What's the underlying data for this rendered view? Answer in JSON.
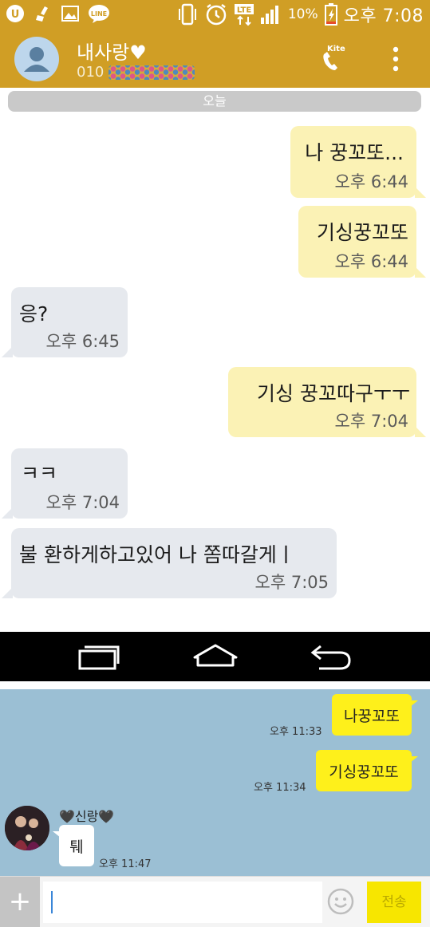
{
  "status_bar": {
    "battery_percent": "10%",
    "time": "오후 7:08",
    "network_label": "LTE",
    "icons": [
      "u-plus-icon",
      "broom-icon",
      "image-icon",
      "line-app-icon",
      "vibrate-icon",
      "alarm-icon",
      "lte-icon",
      "signal-icon",
      "battery-charging-icon"
    ]
  },
  "header": {
    "contact_name": "내사랑♥",
    "phone_prefix": "010",
    "call_badge": "Kite",
    "accent_color": "#d09e25"
  },
  "chat1": {
    "date_label": "오늘",
    "messages": [
      {
        "dir": "out",
        "text": "나 꿍꼬또...",
        "time": "오후 6:44"
      },
      {
        "dir": "out",
        "text": "기싱꿍꼬또",
        "time": "오후 6:44"
      },
      {
        "dir": "in",
        "text": "응?",
        "time": "오후 6:45"
      },
      {
        "dir": "out",
        "text": "기싱 꿍꼬따구ㅜㅜ",
        "time": "오후 7:04"
      },
      {
        "dir": "in",
        "text": "ㅋㅋ",
        "time": "오후 7:04"
      },
      {
        "dir": "in",
        "text": "불 환하게하고있어 나 쫌따갈게ㅣ",
        "time": "오후 7:05"
      }
    ]
  },
  "navbar": {
    "buttons": [
      "recent-apps-icon",
      "home-icon",
      "back-icon"
    ]
  },
  "chat2": {
    "background_color": "#9bbfd4",
    "messages": [
      {
        "dir": "out",
        "text": "나꿍꼬또",
        "time": "오후 11:33"
      },
      {
        "dir": "out",
        "text": "기싱꿍꼬또",
        "time": "오후 11:34"
      },
      {
        "dir": "in",
        "sender": "🖤신랑🖤",
        "text": "퉤",
        "time": "오후 11:47"
      }
    ],
    "input": {
      "placeholder": "",
      "plus_label": "+",
      "send_label": "전송"
    }
  }
}
